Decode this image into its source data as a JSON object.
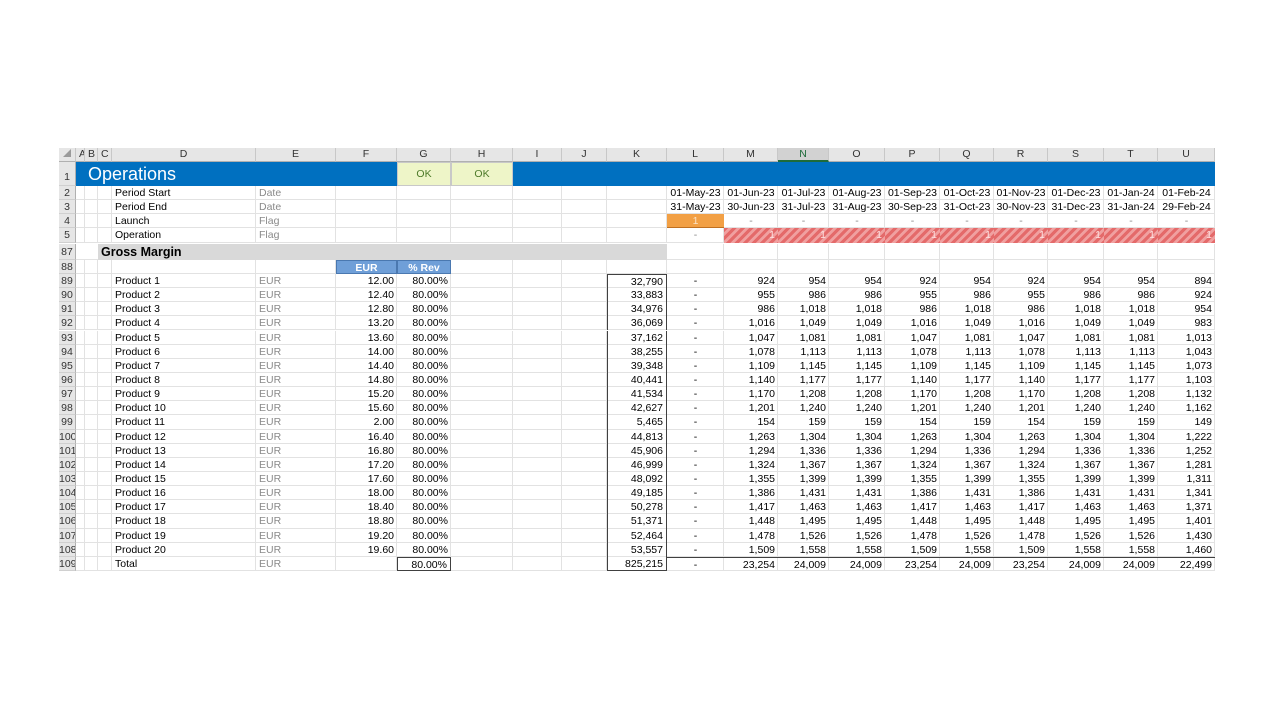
{
  "columns": [
    "A",
    "B",
    "C",
    "D",
    "E",
    "F",
    "G",
    "H",
    "I",
    "J",
    "K",
    "L",
    "M",
    "N",
    "O",
    "P",
    "Q",
    "R",
    "S",
    "T",
    "U"
  ],
  "selected_column": "N",
  "title_row": {
    "row": "1",
    "title": "Operations",
    "check_g": "OK",
    "check_h": "OK"
  },
  "timing_rows": [
    {
      "row": "2",
      "label": "Period Start",
      "unit": "Date",
      "values": [
        "01-May-23",
        "01-Jun-23",
        "01-Jul-23",
        "01-Aug-23",
        "01-Sep-23",
        "01-Oct-23",
        "01-Nov-23",
        "01-Dec-23",
        "01-Jan-24",
        "01-Feb-24"
      ]
    },
    {
      "row": "3",
      "label": "Period End",
      "unit": "Date",
      "values": [
        "31-May-23",
        "30-Jun-23",
        "31-Jul-23",
        "31-Aug-23",
        "30-Sep-23",
        "31-Oct-23",
        "30-Nov-23",
        "31-Dec-23",
        "31-Jan-24",
        "29-Feb-24"
      ]
    },
    {
      "row": "4",
      "label": "Launch",
      "unit": "Flag",
      "values": [
        "1",
        "-",
        "-",
        "-",
        "-",
        "-",
        "-",
        "-",
        "-",
        "-"
      ]
    },
    {
      "row": "5",
      "label": "Operation",
      "unit": "Flag",
      "values": [
        "-",
        "1",
        "1",
        "1",
        "1",
        "1",
        "1",
        "1",
        "1",
        "1"
      ]
    }
  ],
  "section": {
    "row": "87",
    "title": "Gross Margin"
  },
  "subheader": {
    "row": "88",
    "price_header": "EUR",
    "pct_header": "% Rev"
  },
  "products": [
    {
      "row": "89",
      "name": "Product 1",
      "unit": "EUR",
      "price": "12.00",
      "pct": "80.00%",
      "total": "32,790",
      "months": [
        "-",
        "924",
        "954",
        "954",
        "924",
        "954",
        "924",
        "954",
        "954",
        "894"
      ]
    },
    {
      "row": "90",
      "name": "Product 2",
      "unit": "EUR",
      "price": "12.40",
      "pct": "80.00%",
      "total": "33,883",
      "months": [
        "-",
        "955",
        "986",
        "986",
        "955",
        "986",
        "955",
        "986",
        "986",
        "924"
      ]
    },
    {
      "row": "91",
      "name": "Product 3",
      "unit": "EUR",
      "price": "12.80",
      "pct": "80.00%",
      "total": "34,976",
      "months": [
        "-",
        "986",
        "1,018",
        "1,018",
        "986",
        "1,018",
        "986",
        "1,018",
        "1,018",
        "954"
      ]
    },
    {
      "row": "92",
      "name": "Product 4",
      "unit": "EUR",
      "price": "13.20",
      "pct": "80.00%",
      "total": "36,069",
      "months": [
        "-",
        "1,016",
        "1,049",
        "1,049",
        "1,016",
        "1,049",
        "1,016",
        "1,049",
        "1,049",
        "983"
      ]
    },
    {
      "row": "93",
      "name": "Product 5",
      "unit": "EUR",
      "price": "13.60",
      "pct": "80.00%",
      "total": "37,162",
      "months": [
        "-",
        "1,047",
        "1,081",
        "1,081",
        "1,047",
        "1,081",
        "1,047",
        "1,081",
        "1,081",
        "1,013"
      ]
    },
    {
      "row": "94",
      "name": "Product 6",
      "unit": "EUR",
      "price": "14.00",
      "pct": "80.00%",
      "total": "38,255",
      "months": [
        "-",
        "1,078",
        "1,113",
        "1,113",
        "1,078",
        "1,113",
        "1,078",
        "1,113",
        "1,113",
        "1,043"
      ]
    },
    {
      "row": "95",
      "name": "Product 7",
      "unit": "EUR",
      "price": "14.40",
      "pct": "80.00%",
      "total": "39,348",
      "months": [
        "-",
        "1,109",
        "1,145",
        "1,145",
        "1,109",
        "1,145",
        "1,109",
        "1,145",
        "1,145",
        "1,073"
      ]
    },
    {
      "row": "96",
      "name": "Product 8",
      "unit": "EUR",
      "price": "14.80",
      "pct": "80.00%",
      "total": "40,441",
      "months": [
        "-",
        "1,140",
        "1,177",
        "1,177",
        "1,140",
        "1,177",
        "1,140",
        "1,177",
        "1,177",
        "1,103"
      ]
    },
    {
      "row": "97",
      "name": "Product 9",
      "unit": "EUR",
      "price": "15.20",
      "pct": "80.00%",
      "total": "41,534",
      "months": [
        "-",
        "1,170",
        "1,208",
        "1,208",
        "1,170",
        "1,208",
        "1,170",
        "1,208",
        "1,208",
        "1,132"
      ]
    },
    {
      "row": "98",
      "name": "Product 10",
      "unit": "EUR",
      "price": "15.60",
      "pct": "80.00%",
      "total": "42,627",
      "months": [
        "-",
        "1,201",
        "1,240",
        "1,240",
        "1,201",
        "1,240",
        "1,201",
        "1,240",
        "1,240",
        "1,162"
      ]
    },
    {
      "row": "99",
      "name": "Product 11",
      "unit": "EUR",
      "price": "2.00",
      "pct": "80.00%",
      "total": "5,465",
      "months": [
        "-",
        "154",
        "159",
        "159",
        "154",
        "159",
        "154",
        "159",
        "159",
        "149"
      ]
    },
    {
      "row": "100",
      "name": "Product 12",
      "unit": "EUR",
      "price": "16.40",
      "pct": "80.00%",
      "total": "44,813",
      "months": [
        "-",
        "1,263",
        "1,304",
        "1,304",
        "1,263",
        "1,304",
        "1,263",
        "1,304",
        "1,304",
        "1,222"
      ]
    },
    {
      "row": "101",
      "name": "Product 13",
      "unit": "EUR",
      "price": "16.80",
      "pct": "80.00%",
      "total": "45,906",
      "months": [
        "-",
        "1,294",
        "1,336",
        "1,336",
        "1,294",
        "1,336",
        "1,294",
        "1,336",
        "1,336",
        "1,252"
      ]
    },
    {
      "row": "102",
      "name": "Product 14",
      "unit": "EUR",
      "price": "17.20",
      "pct": "80.00%",
      "total": "46,999",
      "months": [
        "-",
        "1,324",
        "1,367",
        "1,367",
        "1,324",
        "1,367",
        "1,324",
        "1,367",
        "1,367",
        "1,281"
      ]
    },
    {
      "row": "103",
      "name": "Product 15",
      "unit": "EUR",
      "price": "17.60",
      "pct": "80.00%",
      "total": "48,092",
      "months": [
        "-",
        "1,355",
        "1,399",
        "1,399",
        "1,355",
        "1,399",
        "1,355",
        "1,399",
        "1,399",
        "1,311"
      ]
    },
    {
      "row": "104",
      "name": "Product 16",
      "unit": "EUR",
      "price": "18.00",
      "pct": "80.00%",
      "total": "49,185",
      "months": [
        "-",
        "1,386",
        "1,431",
        "1,431",
        "1,386",
        "1,431",
        "1,386",
        "1,431",
        "1,431",
        "1,341"
      ]
    },
    {
      "row": "105",
      "name": "Product 17",
      "unit": "EUR",
      "price": "18.40",
      "pct": "80.00%",
      "total": "50,278",
      "months": [
        "-",
        "1,417",
        "1,463",
        "1,463",
        "1,417",
        "1,463",
        "1,417",
        "1,463",
        "1,463",
        "1,371"
      ]
    },
    {
      "row": "106",
      "name": "Product 18",
      "unit": "EUR",
      "price": "18.80",
      "pct": "80.00%",
      "total": "51,371",
      "months": [
        "-",
        "1,448",
        "1,495",
        "1,495",
        "1,448",
        "1,495",
        "1,448",
        "1,495",
        "1,495",
        "1,401"
      ]
    },
    {
      "row": "107",
      "name": "Product 19",
      "unit": "EUR",
      "price": "19.20",
      "pct": "80.00%",
      "total": "52,464",
      "months": [
        "-",
        "1,478",
        "1,526",
        "1,526",
        "1,478",
        "1,526",
        "1,478",
        "1,526",
        "1,526",
        "1,430"
      ]
    },
    {
      "row": "108",
      "name": "Product 20",
      "unit": "EUR",
      "price": "19.60",
      "pct": "80.00%",
      "total": "53,557",
      "months": [
        "-",
        "1,509",
        "1,558",
        "1,558",
        "1,509",
        "1,558",
        "1,509",
        "1,558",
        "1,558",
        "1,460"
      ]
    }
  ],
  "total_row": {
    "row": "109",
    "name": "Total",
    "unit": "EUR",
    "pct": "80.00%",
    "total": "825,215",
    "months": [
      "-",
      "23,254",
      "24,009",
      "24,009",
      "23,254",
      "24,009",
      "23,254",
      "24,009",
      "24,009",
      "22,499"
    ]
  },
  "colors": {
    "title_band": "#0070c0",
    "ok_fill": "#eef5c8",
    "header_blue": "#6f9fd8",
    "launch": "#f2a045",
    "operation": "#e46a6a"
  }
}
